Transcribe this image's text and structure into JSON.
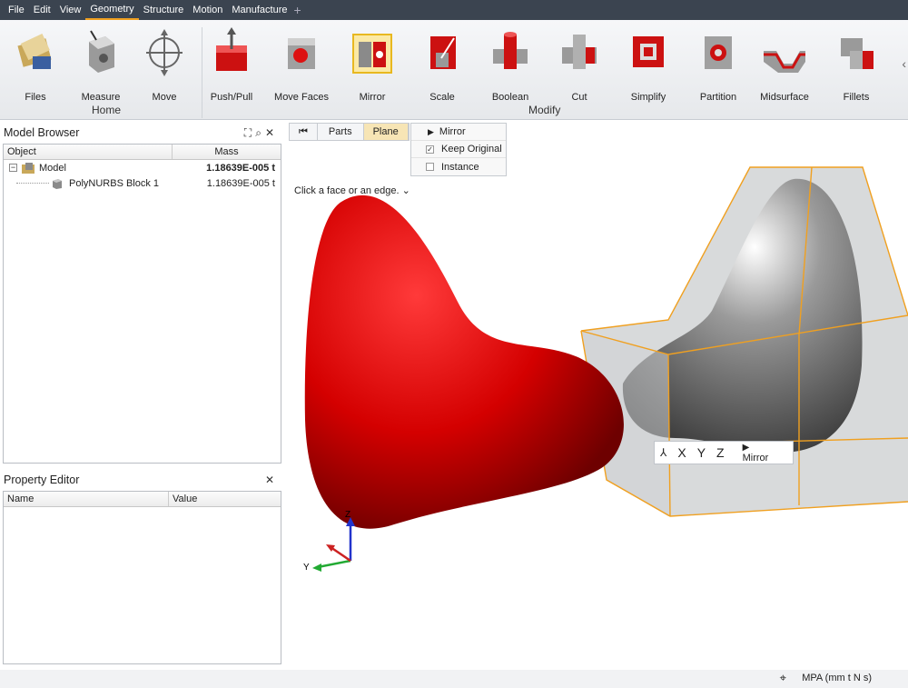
{
  "menubar": {
    "items": [
      "File",
      "Edit",
      "View",
      "Geometry",
      "Structure",
      "Motion",
      "Manufacture"
    ],
    "active": "Geometry"
  },
  "ribbon": {
    "groups": {
      "home": "Home",
      "modify": "Modify"
    },
    "tools": {
      "files": "Files",
      "measure": "Measure",
      "move": "Move",
      "push_pull": "Push/Pull",
      "move_faces": "Move Faces",
      "mirror": "Mirror",
      "scale": "Scale",
      "boolean": "Boolean",
      "cut": "Cut",
      "simplify": "Simplify",
      "partition": "Partition",
      "midsurface": "Midsurface",
      "fillets": "Fillets"
    },
    "scroll_glyph": "‹"
  },
  "model_browser": {
    "title": "Model Browser",
    "columns": {
      "object": "Object",
      "mass": "Mass"
    },
    "rows": [
      {
        "name": "Model",
        "mass": "1.18639E-005 t"
      },
      {
        "name": "PolyNURBS Block 1",
        "mass": "1.18639E-005 t"
      }
    ]
  },
  "property_editor": {
    "title": "Property Editor",
    "columns": {
      "name": "Name",
      "value": "Value"
    }
  },
  "viewport": {
    "tabs": {
      "parts": "Parts",
      "plane": "Plane"
    },
    "mirror_menu": {
      "mirror": "Mirror",
      "keep_original": "Keep Original",
      "instance": "Instance"
    },
    "hint": "Click a face or an edge.",
    "mini_toolbar": {
      "x": "X",
      "y": "Y",
      "z": "Z",
      "mirror": "Mirror"
    },
    "triad": {
      "z": "Z",
      "y": "Y"
    }
  },
  "statusbar": {
    "units": "MPA (mm t N s)"
  },
  "colors": {
    "accent": "#f0a020",
    "shape_red": "#cc0000",
    "menubar": "#3b4450"
  }
}
